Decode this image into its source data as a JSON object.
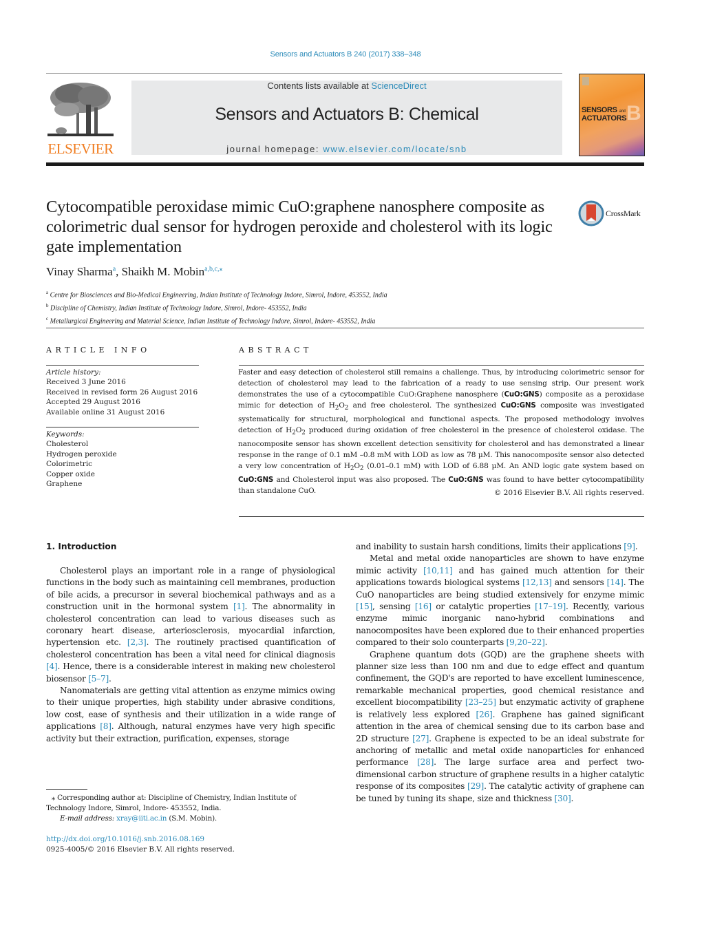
{
  "header": {
    "journal_ref": "Sensors and Actuators B 240 (2017) 338–348",
    "contents_prefix": "Contents lists available at ",
    "contents_link": "ScienceDirect",
    "journal_title": "Sensors and Actuators B: Chemical",
    "homepage_prefix": "journal homepage: ",
    "homepage_link": "www.elsevier.com/locate/snb",
    "publisher_logo_text": "ELSEVIER",
    "cover_line1": "SENSORS",
    "cover_and": "and",
    "cover_line2": "ACTUATORS",
    "cover_letter": "B",
    "accent_color": "#2a8ab8",
    "publisher_color": "#f07c1f"
  },
  "article": {
    "title": "Cytocompatible peroxidase mimic CuO:graphene nanosphere composite as colorimetric dual sensor for hydrogen peroxide and cholesterol with its logic gate implementation",
    "crossmark_label": "CrossMark",
    "authors": [
      {
        "name": "Vinay Sharma",
        "affil": "a"
      },
      {
        "name": "Shaikh M. Mobin",
        "affil": "a,b,c,⁎"
      }
    ],
    "author_sep": ", ",
    "affiliations": [
      {
        "mark": "a",
        "text": "Centre for Biosciences and Bio-Medical Engineering, Indian Institute of Technology Indore, Simrol, Indore, 453552, India"
      },
      {
        "mark": "b",
        "text": "Discipline of Chemistry, Indian Institute of Technology Indore, Simrol, Indore- 453552, India"
      },
      {
        "mark": "c",
        "text": "Metallurgical Engineering and Material Science, Indian Institute of Technology Indore, Simrol, Indore- 453552, India"
      }
    ]
  },
  "article_info": {
    "heading": "ARTICLE INFO",
    "history_label": "Article history:",
    "history": [
      "Received 3 June 2016",
      "Received in revised form 26 August 2016",
      "Accepted 29 August 2016",
      "Available online 31 August 2016"
    ],
    "keywords_label": "Keywords:",
    "keywords": [
      "Cholesterol",
      "Hydrogen peroxide",
      "Colorimetric",
      "Copper oxide",
      "Graphene"
    ]
  },
  "abstract": {
    "heading": "ABSTRACT",
    "parts": [
      {
        "t": "Faster and easy detection of cholesterol still remains a challenge. Thus, by introducing colorimetric sensor for detection of cholesterol may lead to the fabrication of a ready to use sensing strip. Our present work demonstrates the use of a cytocompatible CuO:Graphene nanosphere ("
      },
      {
        "b": "CuO:GNS"
      },
      {
        "t": ") composite as a peroxidase mimic for detection of H"
      },
      {
        "sub": "2"
      },
      {
        "t": "O"
      },
      {
        "sub": "2"
      },
      {
        "t": " and free cholesterol. The synthesized "
      },
      {
        "b": "CuO:GNS"
      },
      {
        "t": " composite was investigated systematically for structural, morphological and functional aspects. The proposed methodology involves detection of H"
      },
      {
        "sub": "2"
      },
      {
        "t": "O"
      },
      {
        "sub": "2"
      },
      {
        "t": " produced during oxidation of free cholesterol in the presence of cholesterol oxidase. The nanocomposite sensor has shown excellent detection sensitivity for cholesterol and has demonstrated a linear response in the range of 0.1 mM –0.8 mM with LOD as low as 78 µM. This nanocomposite sensor also detected a very low concentration of H"
      },
      {
        "sub": "2"
      },
      {
        "t": "O"
      },
      {
        "sub": "2"
      },
      {
        "t": " (0.01–0.1 mM) with LOD of 6.88 µM. An AND logic gate system based on "
      },
      {
        "b": "CuO:GNS"
      },
      {
        "t": " and Cholesterol input was also proposed. The "
      },
      {
        "b": "CuO:GNS"
      },
      {
        "t": " was found to have better cytocompatibility than standalone CuO."
      }
    ],
    "copyright": "© 2016 Elsevier B.V. All rights reserved."
  },
  "body": {
    "section_heading": "1.  Introduction",
    "left_paragraphs": [
      [
        {
          "t": "Cholesterol plays an important role in a range of physiological functions in the body such as maintaining cell membranes, production of bile acids, a precursor in several biochemical pathways and as a construction unit in the hormonal system "
        },
        {
          "c": "[1]"
        },
        {
          "t": ". The abnormality in cholesterol concentration can lead to various diseases such as coronary heart disease, arteriosclerosis, myocardial infarction, hypertension etc. "
        },
        {
          "c": "[2,3]"
        },
        {
          "t": ". The routinely practised quantification of cholesterol concentration has been a vital need for clinical diagnosis "
        },
        {
          "c": "[4]"
        },
        {
          "t": ". Hence, there is a considerable interest in making new cholesterol biosensor "
        },
        {
          "c": "[5–7]"
        },
        {
          "t": "."
        }
      ],
      [
        {
          "t": "Nanomaterials are getting vital attention as enzyme mimics owing to their unique properties, high stability under abrasive conditions, low cost, ease of synthesis and their utilization in a wide range of applications "
        },
        {
          "c": "[8]"
        },
        {
          "t": ". Although, natural enzymes have very high specific activity but their extraction, purification, expenses, storage"
        }
      ]
    ],
    "right_paragraphs": [
      [
        {
          "t": "and inability to sustain harsh conditions, limits their applications "
        },
        {
          "c": "[9]"
        },
        {
          "t": "."
        }
      ],
      [
        {
          "t": "Metal and metal oxide nanoparticles are shown to have enzyme mimic activity "
        },
        {
          "c": "[10,11]"
        },
        {
          "t": " and has gained much attention for their applications towards biological systems "
        },
        {
          "c": "[12,13]"
        },
        {
          "t": " and sensors "
        },
        {
          "c": "[14]"
        },
        {
          "t": ". The CuO nanoparticles are being studied extensively for enzyme mimic "
        },
        {
          "c": "[15]"
        },
        {
          "t": ", sensing "
        },
        {
          "c": "[16]"
        },
        {
          "t": " or catalytic properties "
        },
        {
          "c": "[17–19]"
        },
        {
          "t": ". Recently, various enzyme mimic inorganic nano-hybrid combinations and nanocomposites have been explored due to their enhanced properties compared to their solo counterparts "
        },
        {
          "c": "[9,20–22]"
        },
        {
          "t": "."
        }
      ],
      [
        {
          "t": "Graphene quantum dots (GQD) are the graphene sheets with planner size less than 100 nm and due to edge effect and quantum confinement, the GQD's are reported to have excellent luminescence, remarkable mechanical properties, good chemical resistance and excellent biocompatibility "
        },
        {
          "c": "[23–25]"
        },
        {
          "t": " but enzymatic activity of graphene is relatively less explored "
        },
        {
          "c": "[26]"
        },
        {
          "t": ". Graphene has gained significant attention in the area of chemical sensing due to its carbon base and 2D structure "
        },
        {
          "c": "[27]"
        },
        {
          "t": ". Graphene is expected to be an ideal substrate for anchoring of metallic and metal oxide nanoparticles for enhanced performance "
        },
        {
          "c": "[28]"
        },
        {
          "t": ". The large surface area and perfect two-dimensional carbon structure of graphene results in a higher catalytic response of its composites "
        },
        {
          "c": "[29]"
        },
        {
          "t": ". The catalytic activity of graphene can be tuned by tuning its shape, size and thickness "
        },
        {
          "c": "[30]"
        },
        {
          "t": "."
        }
      ]
    ]
  },
  "footnote": {
    "marker": "⁎",
    "corresponding": " Corresponding author at: Discipline of Chemistry, Indian Institute of Technology Indore, Simrol, Indore- 453552, India.",
    "email_label": "E-mail address: ",
    "email": "xray@iiti.ac.in",
    "email_suffix": " (S.M. Mobin).",
    "doi": "http://dx.doi.org/10.1016/j.snb.2016.08.169",
    "issn": "0925-4005/© 2016 Elsevier B.V. All rights reserved."
  }
}
